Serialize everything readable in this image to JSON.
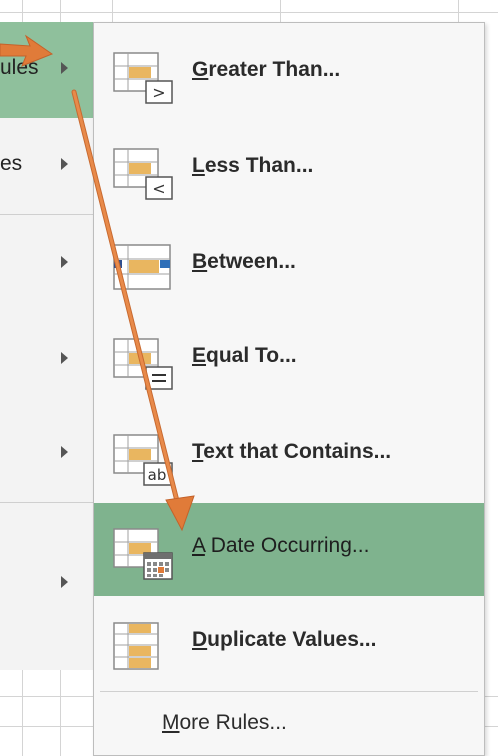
{
  "parent_menu": {
    "items": [
      {
        "label": "ules",
        "active": true
      },
      {
        "label": "es",
        "active": false
      },
      {
        "label": "",
        "active": false
      },
      {
        "label": "",
        "active": false
      },
      {
        "label": "",
        "active": false
      },
      {
        "label": "",
        "active": false
      }
    ]
  },
  "submenu": {
    "items": [
      {
        "accel": "G",
        "rest": "reater Than...",
        "icon": "greater-than-icon",
        "highlighted": false
      },
      {
        "accel": "L",
        "rest": "ess Than...",
        "icon": "less-than-icon",
        "highlighted": false
      },
      {
        "accel": "B",
        "rest": "etween...",
        "icon": "between-icon",
        "highlighted": false
      },
      {
        "accel": "E",
        "rest": "qual To...",
        "icon": "equal-to-icon",
        "highlighted": false
      },
      {
        "accel": "T",
        "rest": "ext that Contains...",
        "icon": "text-contains-icon",
        "highlighted": false
      },
      {
        "accel": "A",
        "rest": " Date Occurring...",
        "icon": "date-occurring-icon",
        "highlighted": true
      },
      {
        "accel": "D",
        "rest": "uplicate Values...",
        "icon": "duplicate-values-icon",
        "highlighted": false
      }
    ],
    "more_rules": {
      "accel": "M",
      "rest": "ore Rules..."
    }
  },
  "colors": {
    "highlight": "#7fb38e",
    "parent_active": "#8fc09c",
    "annotation_arrow": "#e07b39"
  }
}
